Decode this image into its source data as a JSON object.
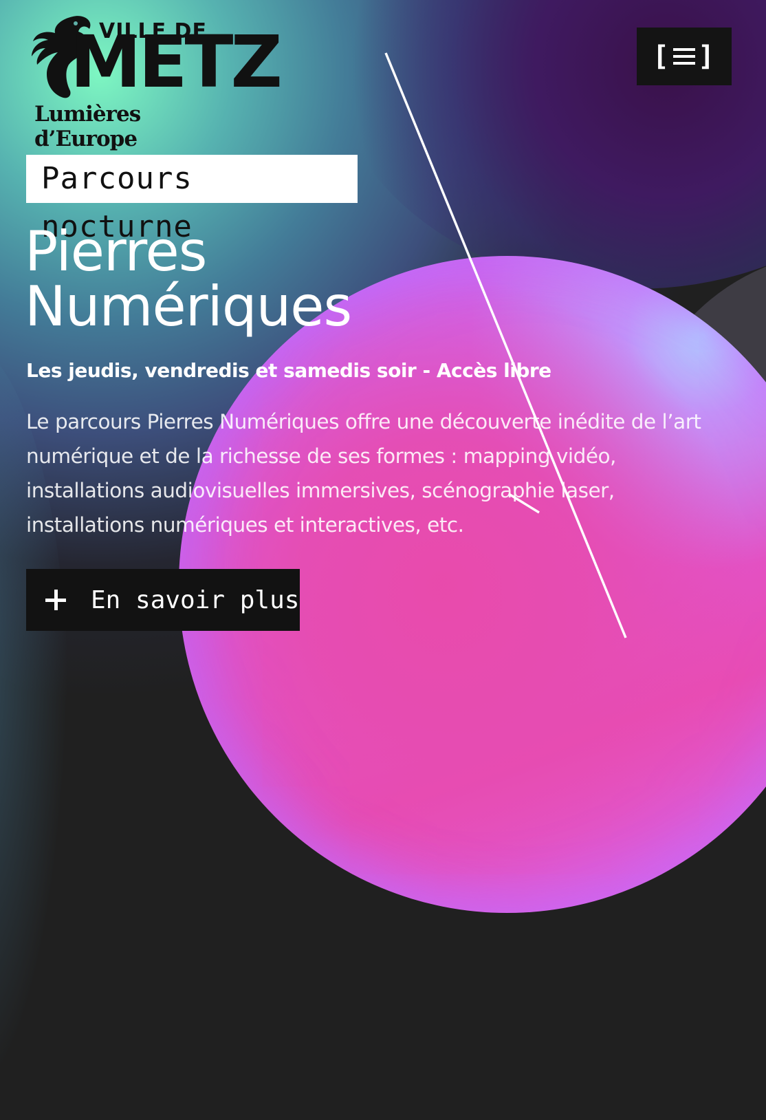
{
  "header": {
    "logo": {
      "line1": "VILLE DE",
      "line2": "METZ",
      "tagline": "Lumières d’Europe"
    },
    "menu_button": {
      "open_bracket": "[",
      "close_bracket": "]",
      "icon": "hamburger-icon"
    }
  },
  "hero": {
    "tag": "Parcours nocturne",
    "title_line1": "Pierres",
    "title_line2": "Numériques",
    "subtitle": "Les jeudis, vendredis et samedis soir - Accès libre",
    "description": "Le parcours Pierres Numériques offre une découverte inédite de l’art numérique et de la richesse de ses formes : mapping vidéo, installations audiovisuelles immersives, scénographie laser, installations numériques et interactives, etc.",
    "cta": {
      "icon": "plus-icon",
      "label": "En savoir plus"
    }
  },
  "colors": {
    "background": "#202020",
    "orb_pink": "#e84cb4",
    "orb_violet": "#c56ef5",
    "glow_green": "#7ef7c2",
    "button_dark": "#121212"
  }
}
